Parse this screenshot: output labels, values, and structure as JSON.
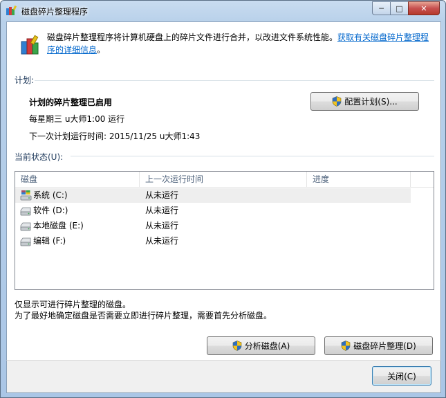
{
  "window": {
    "title": "磁盘碎片整理程序",
    "controls": {
      "minimize": "─",
      "maximize": "□",
      "close": "✕"
    }
  },
  "intro": {
    "text": "磁盘碎片整理程序将计算机硬盘上的碎片文件进行合并，以改进文件系统性能。",
    "link": "获取有关磁盘碎片整理程序的详细信息",
    "tail": "。"
  },
  "schedule": {
    "label": "计划:",
    "status": "计划的碎片整理已启用",
    "frequency": "每星期三  u大师1:00 运行",
    "next_run": "下一次计划运行时间: 2015/11/25 u大师1:43",
    "configure_button": "配置计划(S)..."
  },
  "current_status": {
    "label": "当前状态(U):",
    "columns": [
      "磁盘",
      "上一次运行时间",
      "进度"
    ],
    "rows": [
      {
        "disk": "系统 (C:)",
        "last_run": "从未运行",
        "progress": "",
        "icon": "system-drive-icon"
      },
      {
        "disk": "软件 (D:)",
        "last_run": "从未运行",
        "progress": "",
        "icon": "hard-drive-icon"
      },
      {
        "disk": "本地磁盘 (E:)",
        "last_run": "从未运行",
        "progress": "",
        "icon": "hard-drive-icon"
      },
      {
        "disk": "编辑 (F:)",
        "last_run": "从未运行",
        "progress": "",
        "icon": "hard-drive-icon"
      }
    ]
  },
  "notes": {
    "line1": "仅显示可进行碎片整理的磁盘。",
    "line2": "为了最好地确定磁盘是否需要立即进行碎片整理，需要首先分析磁盘。"
  },
  "actions": {
    "analyze": "分析磁盘(A)",
    "defragment": "磁盘碎片整理(D)",
    "close": "关闭(C)"
  }
}
